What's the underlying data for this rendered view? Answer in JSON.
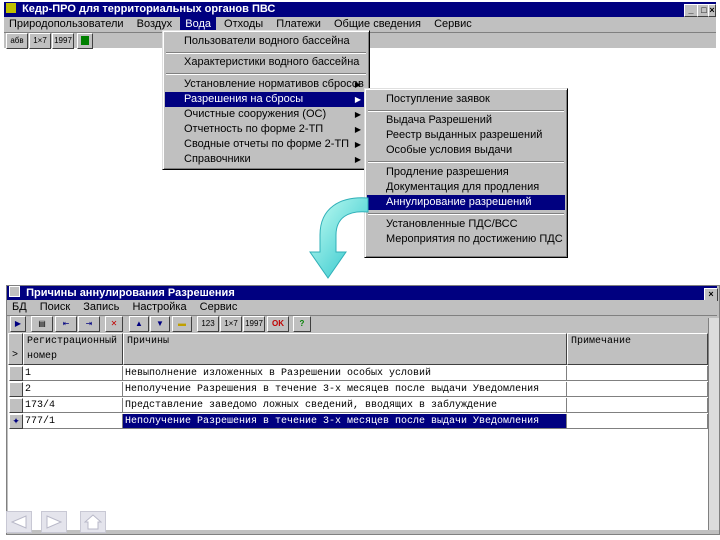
{
  "app": {
    "title": "Кедр-ПРО для территориальных органов ПВС",
    "controls": [
      "_",
      "□",
      "×"
    ]
  },
  "menubar": {
    "items": [
      "Природопользователи",
      "Воздух",
      "Вода",
      "Отходы",
      "Платежи",
      "Общие сведения",
      "Сервис"
    ],
    "active_index": 2
  },
  "toolbar": {
    "buttons": [
      "абв",
      "1×7",
      "1997",
      ""
    ]
  },
  "water_menu": {
    "items": [
      {
        "label": "Пользователи водного бассейна",
        "submenu": false
      },
      {
        "label": "Характеристики водного бассейна",
        "submenu": false
      },
      {
        "label": "Установление нормативов сбросов",
        "submenu": true
      },
      {
        "label": "Разрешения на сбросы",
        "submenu": true,
        "selected": true
      },
      {
        "label": "Очистные сооружения (ОС)",
        "submenu": true
      },
      {
        "label": "Отчетность по форме 2-ТП",
        "submenu": true
      },
      {
        "label": "Сводные отчеты по форме 2-ТП",
        "submenu": true
      },
      {
        "label": "Справочники",
        "submenu": true
      }
    ]
  },
  "permits_submenu": {
    "items": [
      "Поступление заявок",
      "Выдача Разрешений",
      "Реестр выданных разрешений",
      "Особые условия выдачи",
      "Продление разрешения",
      "Документация для продления",
      "Аннулирование разрешений",
      "Установленные ПДС/ВСС",
      "Мероприятия по достижению ПДС"
    ],
    "selected_index": 6
  },
  "child_window": {
    "title": "Причины аннулирования Разрешения",
    "close": "×",
    "menu": [
      "БД",
      "Поиск",
      "Запись",
      "Настройка",
      "Сервис"
    ],
    "toolbar": [
      "▶",
      "▤",
      "⇤",
      "⇥",
      "✕",
      "▲",
      "▼",
      "▬",
      "123",
      "1×7",
      "1997",
      "OK",
      "?"
    ]
  },
  "table": {
    "headers": {
      "reg_number_line1": "Регистрационный",
      "reg_number_line2": "номер",
      "reasons": "Причины",
      "notes": "Примечание"
    },
    "rows": [
      {
        "reg": "1",
        "reason": "Невыполнение изложенных в Разрешении особых условий",
        "note": ""
      },
      {
        "reg": "2",
        "reason": "Неполучение Разрешения в течение 3-х месяцев после выдачи Уведомления",
        "note": ""
      },
      {
        "reg": "173/4",
        "reason": "Представление заведомо ложных сведений, вводящих в заблуждение",
        "note": ""
      },
      {
        "reg": "777/1",
        "reason": "Неполучение Разрешения в течение 3-х месяцев после выдачи Уведомления",
        "note": ""
      }
    ],
    "current_row_index": 3,
    "header_indicator": ">",
    "current_indicator": "✦"
  },
  "nav": [
    "back",
    "forward",
    "home"
  ],
  "colors": {
    "titlebar": "#000080",
    "chrome": "#c0c0c0",
    "arrow": "#5fe0d0"
  }
}
